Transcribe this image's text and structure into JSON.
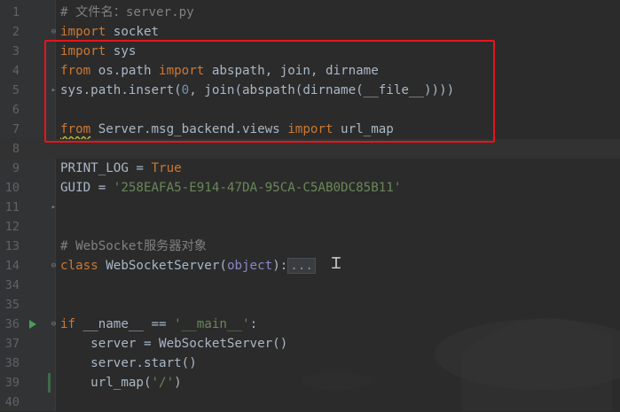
{
  "editor": {
    "lines": [
      {
        "n": "1",
        "tokens": [
          {
            "t": "# 文件名：server.py",
            "c": "comment"
          }
        ]
      },
      {
        "n": "2",
        "tokens": [
          {
            "t": "import",
            "c": "kw"
          },
          {
            "t": " socket",
            "c": ""
          }
        ]
      },
      {
        "n": "3",
        "tokens": [
          {
            "t": "import",
            "c": "kw"
          },
          {
            "t": " sys",
            "c": ""
          }
        ]
      },
      {
        "n": "4",
        "tokens": [
          {
            "t": "from",
            "c": "kw"
          },
          {
            "t": " os.path ",
            "c": ""
          },
          {
            "t": "import",
            "c": "kw"
          },
          {
            "t": " abspath, join, dirname",
            "c": ""
          }
        ]
      },
      {
        "n": "5",
        "tokens": [
          {
            "t": "sys.path.insert(",
            "c": ""
          },
          {
            "t": "0",
            "c": "num"
          },
          {
            "t": ", join(abspath(dirname(__file__))))",
            "c": ""
          }
        ]
      },
      {
        "n": "6",
        "tokens": []
      },
      {
        "n": "7",
        "tokens": [
          {
            "t": "from",
            "c": "kw wavy"
          },
          {
            "t": " Server.msg_backend.views ",
            "c": ""
          },
          {
            "t": "import",
            "c": "kw"
          },
          {
            "t": " url_map",
            "c": ""
          }
        ]
      },
      {
        "n": "8",
        "tokens": [],
        "current": true
      },
      {
        "n": "9",
        "tokens": [
          {
            "t": "PRINT_LOG = ",
            "c": ""
          },
          {
            "t": "True",
            "c": "kw"
          }
        ]
      },
      {
        "n": "10",
        "tokens": [
          {
            "t": "GUID = ",
            "c": ""
          },
          {
            "t": "'258EAFA5-E914-47DA-95CA-C5AB0DC85B11'",
            "c": "str"
          }
        ]
      },
      {
        "n": "11",
        "tokens": []
      },
      {
        "n": "12",
        "tokens": []
      },
      {
        "n": "13",
        "tokens": [
          {
            "t": "# WebSocket服务器对象",
            "c": "comment"
          }
        ]
      },
      {
        "n": "14",
        "tokens": [
          {
            "t": "class",
            "c": "kw"
          },
          {
            "t": " WebSocketServer(",
            "c": ""
          },
          {
            "t": "object",
            "c": "builtin"
          },
          {
            "t": "):",
            "c": ""
          },
          {
            "t": "...",
            "c": "fold"
          }
        ]
      },
      {
        "n": "34",
        "tokens": []
      },
      {
        "n": "35",
        "tokens": []
      },
      {
        "n": "36",
        "tokens": [
          {
            "t": "if",
            "c": "kw"
          },
          {
            "t": " __name__ == ",
            "c": ""
          },
          {
            "t": "'__main__'",
            "c": "str"
          },
          {
            "t": ":",
            "c": ""
          }
        ],
        "run": true
      },
      {
        "n": "37",
        "tokens": [
          {
            "t": "    server = WebSocketServer()",
            "c": ""
          }
        ]
      },
      {
        "n": "38",
        "tokens": [
          {
            "t": "    server.start()",
            "c": ""
          }
        ]
      },
      {
        "n": "39",
        "tokens": [
          {
            "t": "    url_map(",
            "c": ""
          },
          {
            "t": "'/'",
            "c": "str"
          },
          {
            "t": ")",
            "c": ""
          }
        ]
      },
      {
        "n": "40",
        "tokens": []
      }
    ]
  },
  "colors": {
    "background": "#2b2b2b",
    "gutter": "#313335",
    "keyword": "#cc7832",
    "string": "#6a8759",
    "number": "#6897bb",
    "comment": "#808080",
    "text": "#a9b7c6",
    "highlight_box": "#e8141a"
  },
  "icons": {
    "run": "run-triangle-icon",
    "fold": "fold-marker-icon",
    "cursor": "text-cursor-icon"
  }
}
